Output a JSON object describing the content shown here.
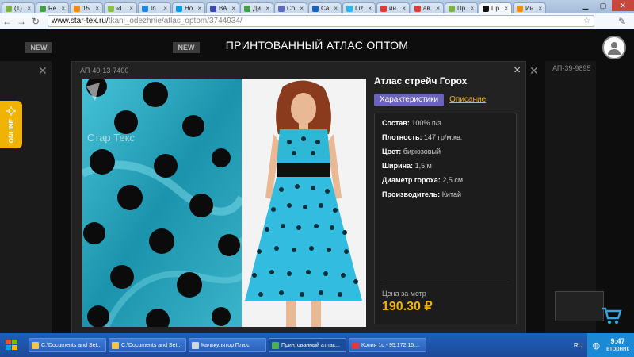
{
  "browser": {
    "tabs": [
      {
        "label": "(1)",
        "color": "#7cb342"
      },
      {
        "label": "Re",
        "color": "#43a047"
      },
      {
        "label": "15",
        "color": "#fb8c00"
      },
      {
        "label": "«Г",
        "color": "#8bc34a"
      },
      {
        "label": "In",
        "color": "#1e88e5"
      },
      {
        "label": "Но",
        "color": "#039be5"
      },
      {
        "label": "ВА",
        "color": "#3949ab"
      },
      {
        "label": "Ди",
        "color": "#43a047"
      },
      {
        "label": "Со",
        "color": "#5c6bc0"
      },
      {
        "label": "Са",
        "color": "#1565c0"
      },
      {
        "label": "Liz",
        "color": "#29b6f6"
      },
      {
        "label": "ин",
        "color": "#e53935"
      },
      {
        "label": "ав",
        "color": "#e53935"
      },
      {
        "label": "Пр",
        "color": "#7cb342"
      },
      {
        "label": "Пр",
        "color": "#111111"
      },
      {
        "label": "Ин",
        "color": "#fb8c00"
      }
    ],
    "url_domain": "www.star-tex.ru/",
    "url_path": "tkani_odezhnie/atlas_optom/3744934/"
  },
  "page": {
    "title": "ПРИНТОВАННЫЙ АТЛАС ОПТОМ",
    "new_badge": "NEW",
    "online_label": "ONLINE",
    "right_card_code": "АП-39-9895"
  },
  "modal": {
    "code": "АП-40-13-7400",
    "close": "×",
    "product_title": "Атлас стрейч Горох",
    "tab_characteristics": "Характеристики",
    "tab_description": "Описание",
    "specs": [
      {
        "label": "Состав:",
        "value": "100% п/э"
      },
      {
        "label": "Плотность:",
        "value": "147 гр/м.кв."
      },
      {
        "label": "Цвет:",
        "value": "бирюзовый"
      },
      {
        "label": "Ширина:",
        "value": "1,5 м"
      },
      {
        "label": "Диаметр гороха:",
        "value": "2,5 см"
      },
      {
        "label": "Производитель:",
        "value": "Китай"
      }
    ],
    "price_label": "Цена за метр",
    "price": "190.30 ₽",
    "watermark": "Стар Текс"
  },
  "taskbar": {
    "tasks": [
      {
        "label": "C:\\Documents and Set...",
        "color": "#f6c343"
      },
      {
        "label": "C:\\Documents and Set...",
        "color": "#f6c343"
      },
      {
        "label": "Калькулятор Плюс",
        "color": "#cfd8dc"
      },
      {
        "label": "Принтованный атлас...",
        "color": "#4caf50"
      },
      {
        "label": "Копия 1с - 95.172.15....",
        "color": "#e53935"
      }
    ],
    "lang": "RU",
    "time": "9:47",
    "day": "вторник"
  },
  "colors": {
    "accent_yellow": "#f0b400",
    "tab_active": "#6b63b5",
    "fabric": "#1f9bb3"
  }
}
